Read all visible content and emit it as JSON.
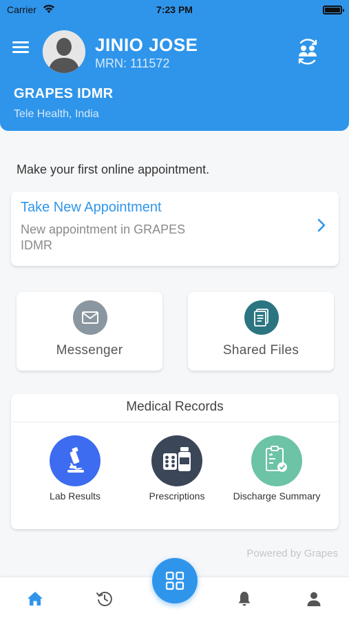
{
  "status_bar": {
    "carrier": "Carrier",
    "time": "7:23 PM"
  },
  "header": {
    "patient_name": "JINIO JOSE",
    "mrn": "MRN: 111572",
    "hospital_name": "GRAPES IDMR",
    "location": "Tele Health, India",
    "background_color": "#2f95ea"
  },
  "intro_text": "Make your first online appointment.",
  "appointment": {
    "title": "Take New Appointment",
    "subtitle": "New appointment in GRAPES IDMR"
  },
  "quick_actions": [
    {
      "label": "Messenger",
      "icon": "mail-icon",
      "color": "#8a97a0"
    },
    {
      "label": "Shared Files",
      "icon": "document-icon",
      "color": "#2b7581"
    }
  ],
  "medical_records": {
    "title": "Medical Records",
    "items": [
      {
        "label": "Lab Results",
        "icon": "microscope-icon",
        "color": "#3d6cf0"
      },
      {
        "label": "Prescriptions",
        "icon": "medicine-icon",
        "color": "#3b4658"
      },
      {
        "label": "Discharge Summary",
        "icon": "clipboard-check-icon",
        "color": "#6cc3a5"
      }
    ]
  },
  "footer_text": "Powered by Grapes",
  "tab_bar": {
    "items": [
      {
        "name": "home",
        "icon": "home-icon",
        "active": true
      },
      {
        "name": "history",
        "icon": "history-icon",
        "active": false
      },
      {
        "name": "dashboard",
        "icon": "grid-icon",
        "active": false
      },
      {
        "name": "notifications",
        "icon": "bell-icon",
        "active": false
      },
      {
        "name": "profile",
        "icon": "user-icon",
        "active": false
      }
    ],
    "active_color": "#2f95ea",
    "inactive_color": "#555555"
  }
}
